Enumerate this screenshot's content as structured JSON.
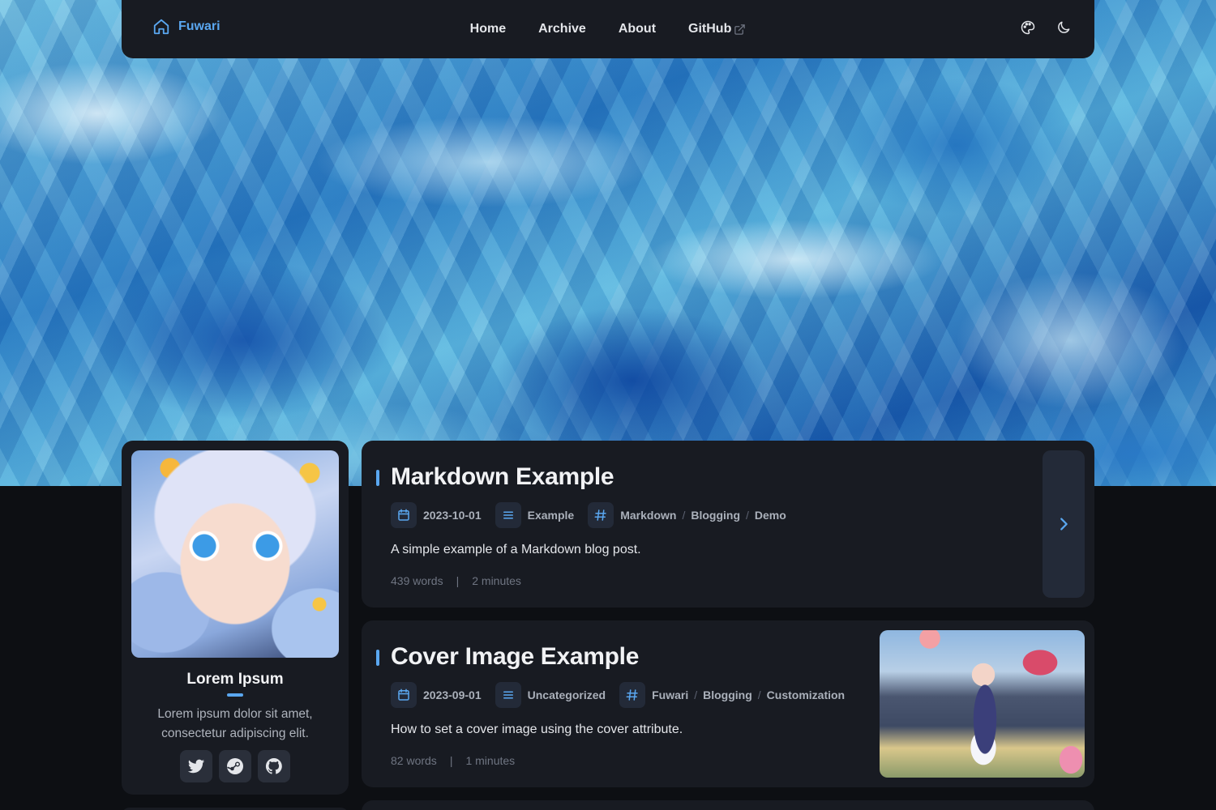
{
  "nav": {
    "brand": "Fuwari",
    "links": [
      {
        "label": "Home"
      },
      {
        "label": "Archive"
      },
      {
        "label": "About"
      },
      {
        "label": "GitHub"
      }
    ],
    "icons": [
      "palette-icon",
      "moon-icon"
    ]
  },
  "profile": {
    "name": "Lorem Ipsum",
    "bio": "Lorem ipsum dolor sit amet, consectetur adipiscing elit.",
    "socials": [
      "twitter-icon",
      "steam-icon",
      "github-icon"
    ]
  },
  "posts": [
    {
      "title": "Markdown Example",
      "date": "2023-10-01",
      "category": "Example",
      "tags": [
        "Markdown",
        "Blogging",
        "Demo"
      ],
      "description": "A simple example of a Markdown blog post.",
      "words": "439 words",
      "time": "2 minutes"
    },
    {
      "title": "Cover Image Example",
      "date": "2023-09-01",
      "category": "Uncategorized",
      "tags": [
        "Fuwari",
        "Blogging",
        "Customization"
      ],
      "description": "How to set a cover image using the cover attribute.",
      "words": "82 words",
      "time": "1 minutes"
    }
  ],
  "stats_separator": "|",
  "tag_separator": "/",
  "colors": {
    "accent": "#5aa7f0",
    "card": "#181b22",
    "page": "#0d0f13"
  }
}
